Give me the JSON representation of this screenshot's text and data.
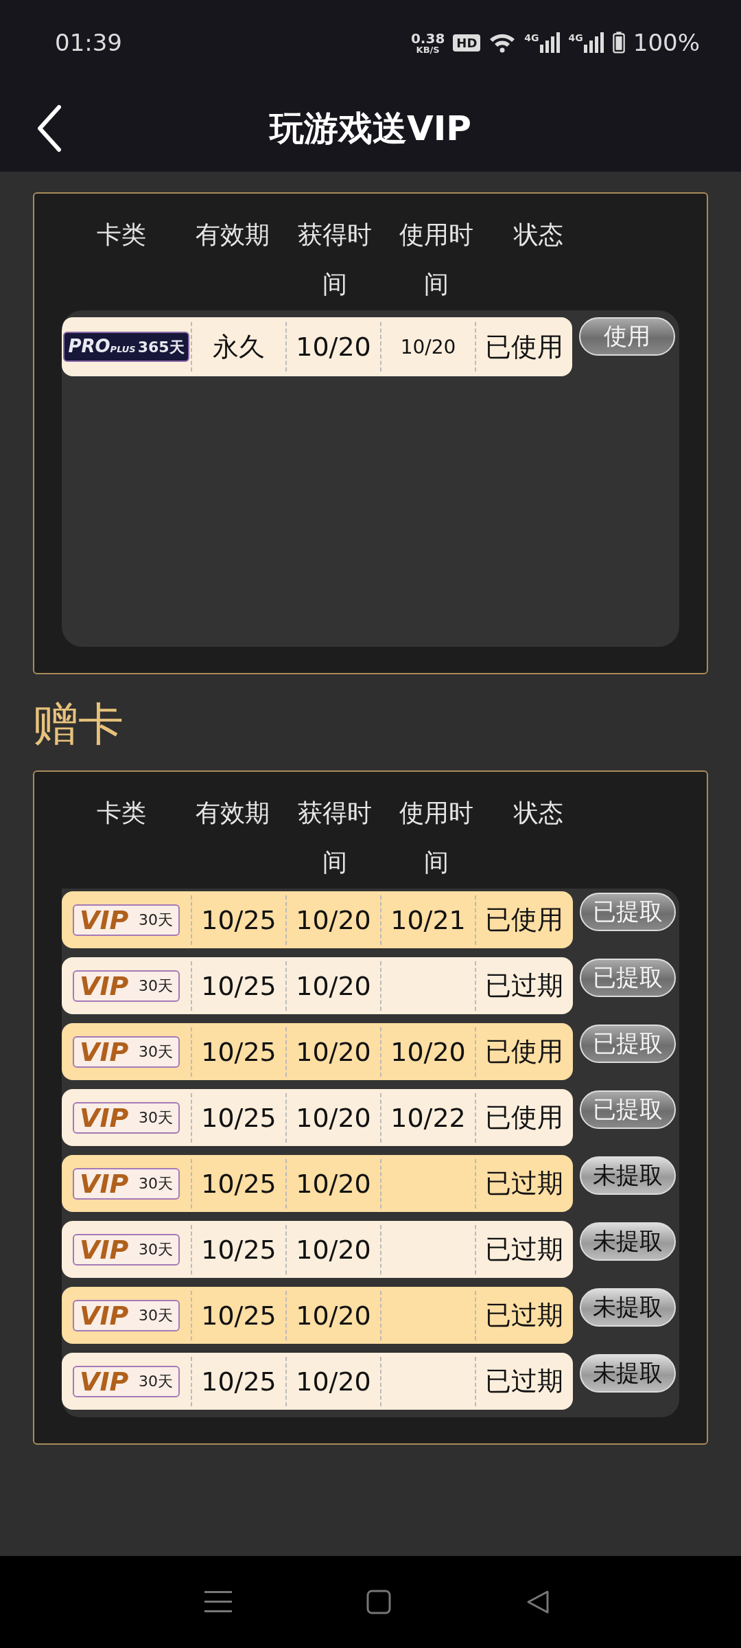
{
  "status_bar": {
    "time": "01:39",
    "speed": "0.38",
    "speed_unit": "KB/S",
    "hd": "HD",
    "network_1": "4G",
    "network_2": "4G",
    "battery": "100%"
  },
  "header": {
    "title": "玩游戏送VIP"
  },
  "owned": {
    "columns": [
      "卡类",
      "有效期",
      "获得时间",
      "使用时间",
      "状态"
    ],
    "rows": [
      {
        "card": {
          "kind": "pro",
          "label": "PRO",
          "sub": "PLUS",
          "days": "365天"
        },
        "validity": "永久",
        "obtained": "10/20",
        "used": "10/20",
        "status": "已使用",
        "action": "使用",
        "claimed": true
      }
    ]
  },
  "gift_title": "赠卡",
  "gifts": {
    "columns": [
      "卡类",
      "有效期",
      "获得时间",
      "使用时间",
      "状态"
    ],
    "rows": [
      {
        "card": {
          "kind": "vip",
          "label": "VIP",
          "days": "30天"
        },
        "validity": "10/25",
        "obtained": "10/20",
        "used": "10/21",
        "status": "已使用",
        "action": "已提取",
        "claimed": true
      },
      {
        "card": {
          "kind": "vip",
          "label": "VIP",
          "days": "30天"
        },
        "validity": "10/25",
        "obtained": "10/20",
        "status": "已过期",
        "action": "已提取",
        "claimed": true
      },
      {
        "card": {
          "kind": "vip",
          "label": "VIP",
          "days": "30天"
        },
        "validity": "10/25",
        "obtained": "10/20",
        "used": "10/20",
        "status": "已使用",
        "action": "已提取",
        "claimed": true
      },
      {
        "card": {
          "kind": "vip",
          "label": "VIP",
          "days": "30天"
        },
        "validity": "10/25",
        "obtained": "10/20",
        "used": "10/22",
        "status": "已使用",
        "action": "已提取",
        "claimed": true
      },
      {
        "card": {
          "kind": "vip",
          "label": "VIP",
          "days": "30天"
        },
        "validity": "10/25",
        "obtained": "10/20",
        "status": "已过期",
        "action": "未提取",
        "claimed": false
      },
      {
        "card": {
          "kind": "vip",
          "label": "VIP",
          "days": "30天"
        },
        "validity": "10/25",
        "obtained": "10/20",
        "status": "已过期",
        "action": "未提取",
        "claimed": false
      },
      {
        "card": {
          "kind": "vip",
          "label": "VIP",
          "days": "30天"
        },
        "validity": "10/25",
        "obtained": "10/20",
        "status": "已过期",
        "action": "未提取",
        "claimed": false
      },
      {
        "card": {
          "kind": "vip",
          "label": "VIP",
          "days": "30天"
        },
        "validity": "10/25",
        "obtained": "10/20",
        "status": "已过期",
        "action": "未提取",
        "claimed": false
      }
    ]
  }
}
